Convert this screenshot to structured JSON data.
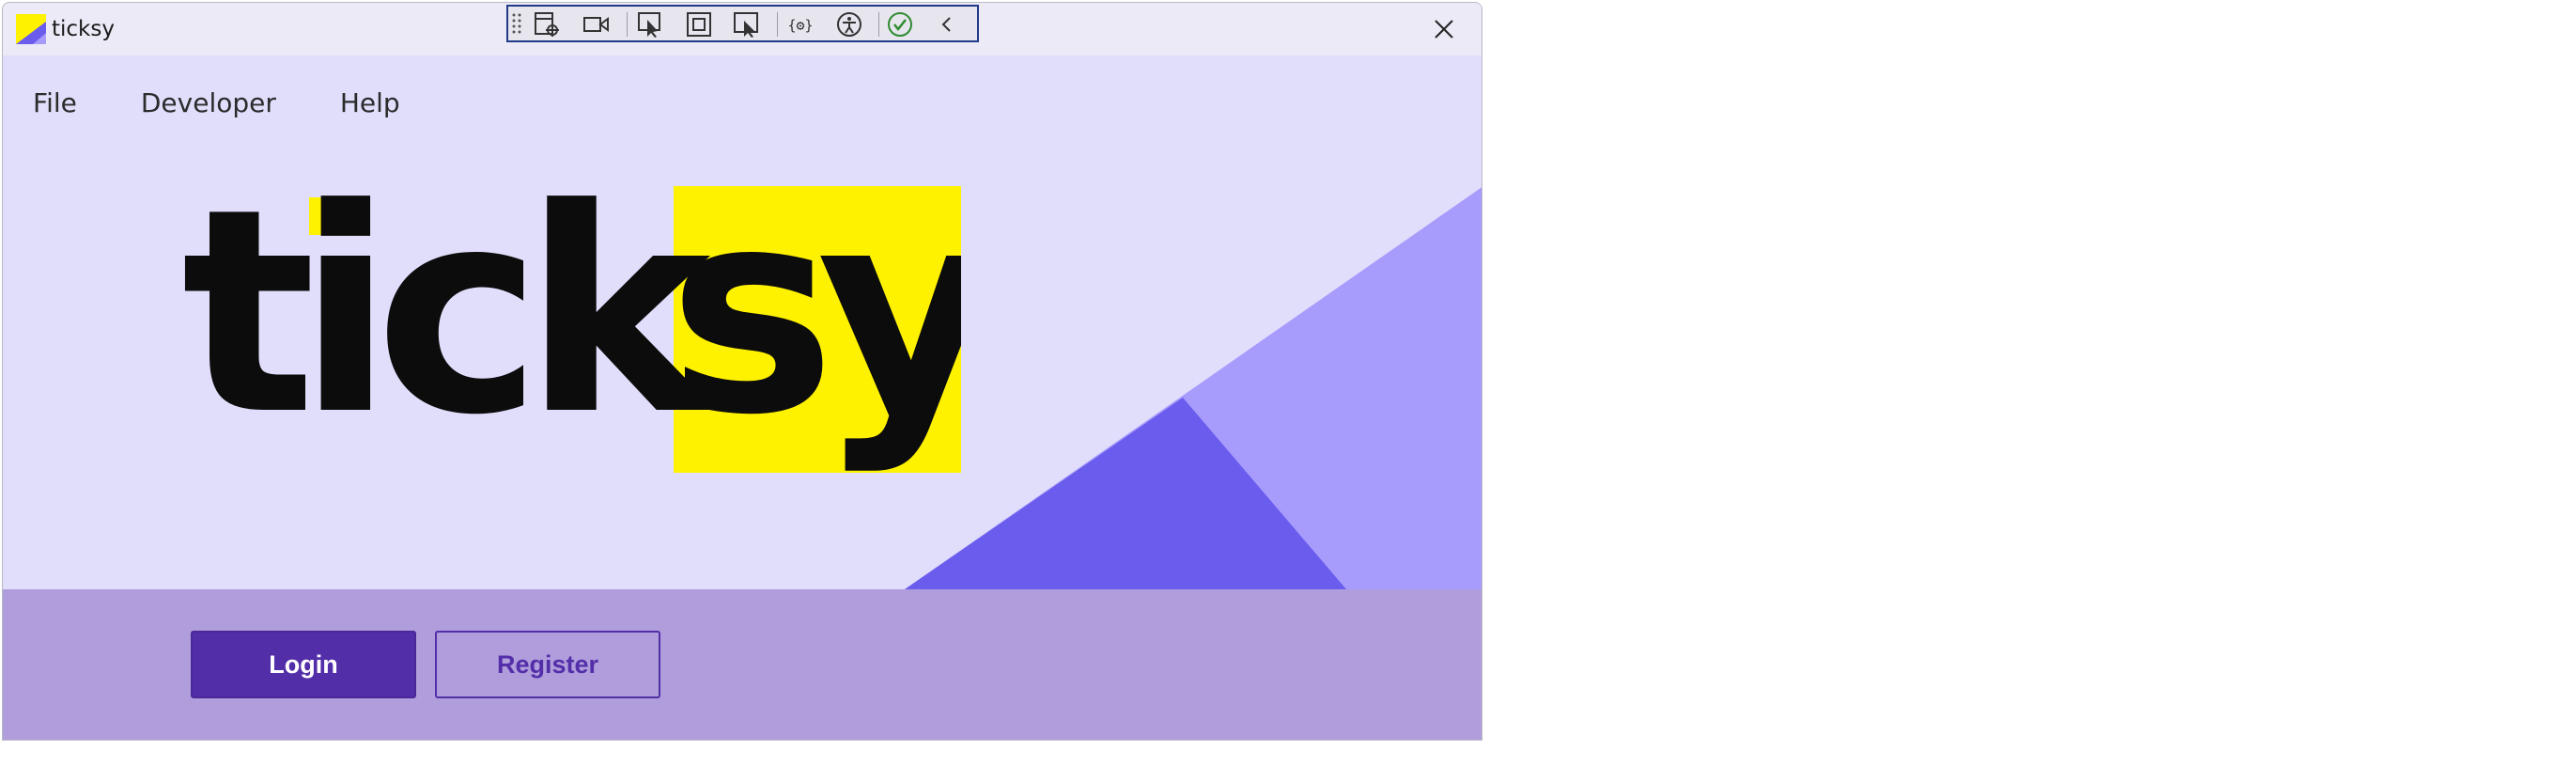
{
  "window": {
    "title": "ticksy",
    "close_glyph": "✕"
  },
  "devtools": {
    "icons": [
      "grip-icon",
      "live-visual-tree-icon",
      "record-icon",
      "select-element-icon",
      "display-layout-adorners-icon",
      "track-focus-icon",
      "binding-failures-icon",
      "accessibility-icon",
      "check-icon",
      "collapse-chevron-icon"
    ]
  },
  "menu": {
    "items": [
      "File",
      "Developer",
      "Help"
    ]
  },
  "logo": {
    "text_dark": "tick",
    "text_highlight": "sy"
  },
  "buttons": {
    "login": "Login",
    "register": "Register"
  },
  "colors": {
    "background": "#e1defc",
    "footer": "#b09ddb",
    "accent": "#532ea9",
    "logo_yellow": "#fff200",
    "triangle_light": "#a79bfc",
    "triangle_dark": "#6a5ced"
  }
}
